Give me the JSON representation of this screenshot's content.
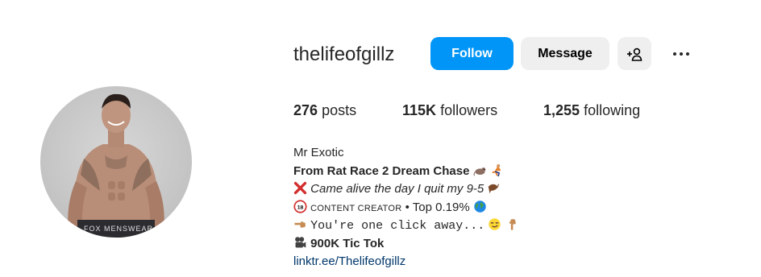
{
  "profile": {
    "username": "thelifeofgillz",
    "follow_label": "Follow",
    "message_label": "Message"
  },
  "stats": {
    "posts_count": "276",
    "posts_label": "posts",
    "followers_count": "115K",
    "followers_label": "followers",
    "following_count": "1,255",
    "following_label": "following"
  },
  "bio": {
    "name": "Mr Exotic",
    "line1": "From Rat Race 2 Dream Chase",
    "line2": "Came alive the day I quit my 9-5",
    "line3_caps": "CONTENT CREATOR",
    "line3_rest": " • Top 0.19%",
    "line4": "You're one click away...",
    "line5": "900K Tic Tok",
    "link": "linktr.ee/Thelifeofgillz"
  },
  "icons": {
    "add_user": "add-user-icon",
    "more": "more-options-icon",
    "rat": "rat-emoji-icon",
    "runner": "runner-emoji-icon",
    "cross": "cross-mark-emoji-icon",
    "eagle": "eagle-emoji-icon",
    "eighteen": "no-under-18-emoji-icon",
    "globe": "globe-emoji-icon",
    "point_left": "pointing-left-emoji-icon",
    "smirk": "smirk-emoji-icon",
    "point_down": "pointing-down-emoji-icon",
    "camera": "movie-camera-emoji-icon"
  },
  "colors": {
    "follow_button": "#0095f6",
    "secondary_button": "#efefef",
    "link": "#00376b",
    "text": "#262626"
  }
}
